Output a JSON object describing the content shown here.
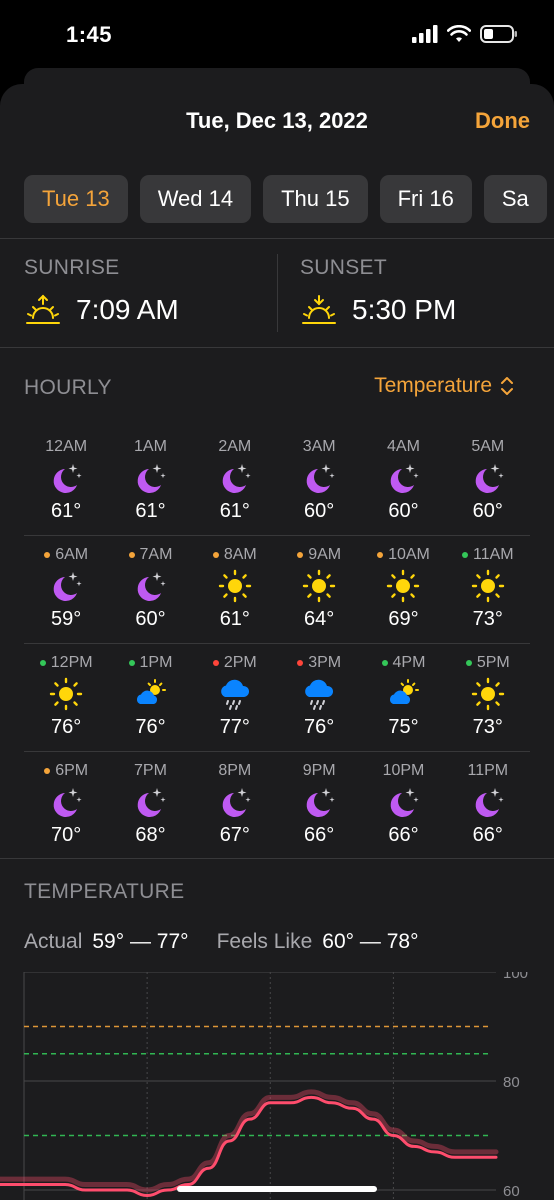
{
  "status": {
    "time": "1:45"
  },
  "sheet": {
    "title": "Tue, Dec 13, 2022",
    "done_label": "Done"
  },
  "days": [
    {
      "label": "Tue 13",
      "selected": true
    },
    {
      "label": "Wed 14",
      "selected": false
    },
    {
      "label": "Thu 15",
      "selected": false
    },
    {
      "label": "Fri 16",
      "selected": false
    },
    {
      "label": "Sa",
      "selected": false
    }
  ],
  "sun": {
    "sunrise_label": "SUNRISE",
    "sunrise_time": "7:09 AM",
    "sunset_label": "SUNSET",
    "sunset_time": "5:30 PM"
  },
  "hourly": {
    "label": "HOURLY",
    "selector": "Temperature",
    "rows": [
      [
        {
          "time": "12AM",
          "icon": "moon-stars-icon",
          "temp": "61°",
          "dot": null
        },
        {
          "time": "1AM",
          "icon": "moon-stars-icon",
          "temp": "61°",
          "dot": null
        },
        {
          "time": "2AM",
          "icon": "moon-stars-icon",
          "temp": "61°",
          "dot": null
        },
        {
          "time": "3AM",
          "icon": "moon-stars-icon",
          "temp": "60°",
          "dot": null
        },
        {
          "time": "4AM",
          "icon": "moon-stars-icon",
          "temp": "60°",
          "dot": null
        },
        {
          "time": "5AM",
          "icon": "moon-stars-icon",
          "temp": "60°",
          "dot": null
        }
      ],
      [
        {
          "time": "6AM",
          "icon": "moon-stars-icon",
          "temp": "59°",
          "dot": "#f4a43a"
        },
        {
          "time": "7AM",
          "icon": "moon-stars-icon",
          "temp": "60°",
          "dot": "#f4a43a"
        },
        {
          "time": "8AM",
          "icon": "sun-icon",
          "temp": "61°",
          "dot": "#f4a43a"
        },
        {
          "time": "9AM",
          "icon": "sun-icon",
          "temp": "64°",
          "dot": "#f4a43a"
        },
        {
          "time": "10AM",
          "icon": "sun-icon",
          "temp": "69°",
          "dot": "#f4a43a"
        },
        {
          "time": "11AM",
          "icon": "sun-icon",
          "temp": "73°",
          "dot": "#34c759"
        }
      ],
      [
        {
          "time": "12PM",
          "icon": "sun-icon",
          "temp": "76°",
          "dot": "#34c759"
        },
        {
          "time": "1PM",
          "icon": "partly-cloudy-icon",
          "temp": "76°",
          "dot": "#34c759"
        },
        {
          "time": "2PM",
          "icon": "rain-cloud-icon",
          "temp": "77°",
          "dot": "#ff453a"
        },
        {
          "time": "3PM",
          "icon": "rain-cloud-icon",
          "temp": "76°",
          "dot": "#ff453a"
        },
        {
          "time": "4PM",
          "icon": "partly-cloudy-icon",
          "temp": "75°",
          "dot": "#34c759"
        },
        {
          "time": "5PM",
          "icon": "sun-icon",
          "temp": "73°",
          "dot": "#34c759"
        }
      ],
      [
        {
          "time": "6PM",
          "icon": "moon-stars-icon",
          "temp": "70°",
          "dot": "#f4a43a"
        },
        {
          "time": "7PM",
          "icon": "moon-stars-icon",
          "temp": "68°",
          "dot": null
        },
        {
          "time": "8PM",
          "icon": "moon-stars-icon",
          "temp": "67°",
          "dot": null
        },
        {
          "time": "9PM",
          "icon": "moon-stars-icon",
          "temp": "66°",
          "dot": null
        },
        {
          "time": "10PM",
          "icon": "moon-stars-icon",
          "temp": "66°",
          "dot": null
        },
        {
          "time": "11PM",
          "icon": "moon-stars-icon",
          "temp": "66°",
          "dot": null
        }
      ]
    ]
  },
  "temperature": {
    "label": "TEMPERATURE",
    "actual_label": "Actual",
    "actual_range": "59° — 77°",
    "feels_label": "Feels Like",
    "feels_range": "60° — 78°"
  },
  "colors": {
    "accent": "#f4a43a",
    "moon": "#bf5af2",
    "sun": "#ffd60a",
    "cloud": "#0a84ff",
    "line": "#ff4d6d"
  },
  "chart_data": {
    "type": "line",
    "ylim": [
      60,
      100
    ],
    "yticks": [
      "100",
      "80",
      "60"
    ],
    "threshold_lines": [
      {
        "value": 90,
        "color": "#f4a43a"
      },
      {
        "value": 85,
        "color": "#34c759"
      },
      {
        "value": 70,
        "color": "#34c759"
      }
    ],
    "x": [
      0,
      1,
      2,
      3,
      4,
      5,
      6,
      7,
      8,
      9,
      10,
      11,
      12,
      13,
      14,
      15,
      16,
      17,
      18,
      19,
      20,
      21,
      22,
      23
    ],
    "series": [
      {
        "values": [
          61,
          61,
          61,
          60,
          60,
          60,
          59,
          60,
          61,
          64,
          69,
          73,
          76,
          76,
          77,
          76,
          75,
          73,
          70,
          68,
          67,
          66,
          66,
          66
        ]
      },
      {
        "values": [
          62,
          62,
          62,
          61,
          61,
          61,
          60,
          61,
          62,
          65,
          70,
          74,
          77,
          77,
          78,
          77,
          76,
          74,
          71,
          69,
          68,
          67,
          67,
          67
        ]
      }
    ]
  }
}
